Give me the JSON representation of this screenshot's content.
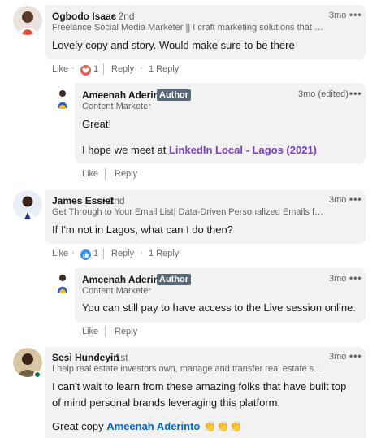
{
  "comments": [
    {
      "name": "Ogbodo Isaac",
      "degree": "• 2nd",
      "headline": "Freelance Social Media Marketer || I craft marketing solutions that help ...",
      "time": "3mo",
      "text": "Lovely copy and story. Would make sure to be there",
      "like": "Like",
      "reaction_count": "1",
      "reply": "Reply",
      "replies_count": "1 Reply",
      "reaction_color": "#e0624e"
    },
    {
      "name": "James Essiet",
      "degree": "• 2nd",
      "headline": "Get Through to Your Email List| Data-Driven Personalized Emails for You...",
      "time": "3mo",
      "text": "If I'm not in Lagos, what can I do then?",
      "like": "Like",
      "reaction_count": "1",
      "reply": "Reply",
      "replies_count": "1 Reply",
      "reaction_color": "#378fe9"
    },
    {
      "name": "Sesi Hundeyin",
      "degree": "• 1st",
      "headline": "I help real estate investors own, manage and transfer real estate succes...",
      "time": "3mo",
      "text": "I can't wait to learn from these amazing folks that have built top of mind personal brands leveraging this platform.",
      "text2_prefix": "Great copy",
      "mention": "Ameenah Aderinto"
    }
  ],
  "replies": [
    {
      "name": "Ameenah Aderinto",
      "badge": "Author",
      "headline": "Content Marketer",
      "time": "3mo (edited)",
      "line1": "Great!",
      "line2_prefix": "I hope we meet at",
      "event": "LinkedIn Local - Lagos (2021)",
      "like": "Like",
      "reply": "Reply"
    },
    {
      "name": "Ameenah Aderinto",
      "badge": "Author",
      "headline": "Content Marketer",
      "time": "3mo",
      "line1": "You can still pay to have access to the Live session online.",
      "like": "Like",
      "reply": "Reply"
    }
  ],
  "more_label": "•••",
  "icons": {
    "heart": "heart-reaction-icon",
    "thumb": "thumbs-up-reaction-icon",
    "clap": "clapping-hands-emoji"
  },
  "emoji": "👏"
}
